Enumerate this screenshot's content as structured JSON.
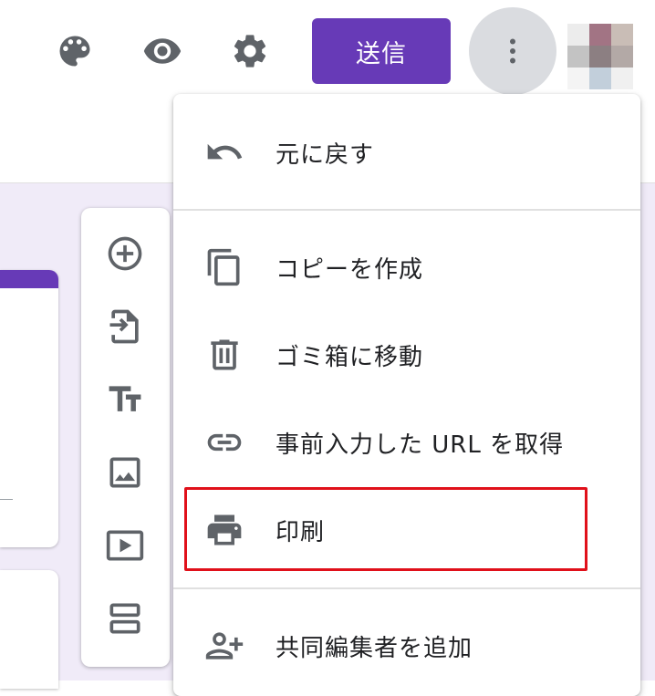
{
  "toolbar": {
    "send_label": "送信",
    "icons": [
      "palette-icon",
      "eye-icon",
      "gear-icon",
      "more-vert-icon"
    ]
  },
  "menu": {
    "items": [
      {
        "label": "元に戻す",
        "icon": "undo-icon"
      },
      {
        "label": "コピーを作成",
        "icon": "copy-icon"
      },
      {
        "label": "ゴミ箱に移動",
        "icon": "trash-icon"
      },
      {
        "label": "事前入力した URL を取得",
        "icon": "link-icon"
      },
      {
        "label": "印刷",
        "icon": "print-icon",
        "highlighted": true
      },
      {
        "label": "共同編集者を追加",
        "icon": "add-people-icon"
      }
    ]
  },
  "side_toolbox": {
    "tools": [
      "add-question-icon",
      "import-questions-icon",
      "add-title-icon",
      "add-image-icon",
      "add-video-icon",
      "add-section-icon"
    ]
  },
  "colors": {
    "accent": "#673ab7",
    "background": "#f0ebf8",
    "highlight": "#e0101a",
    "icon": "#5f6368"
  }
}
